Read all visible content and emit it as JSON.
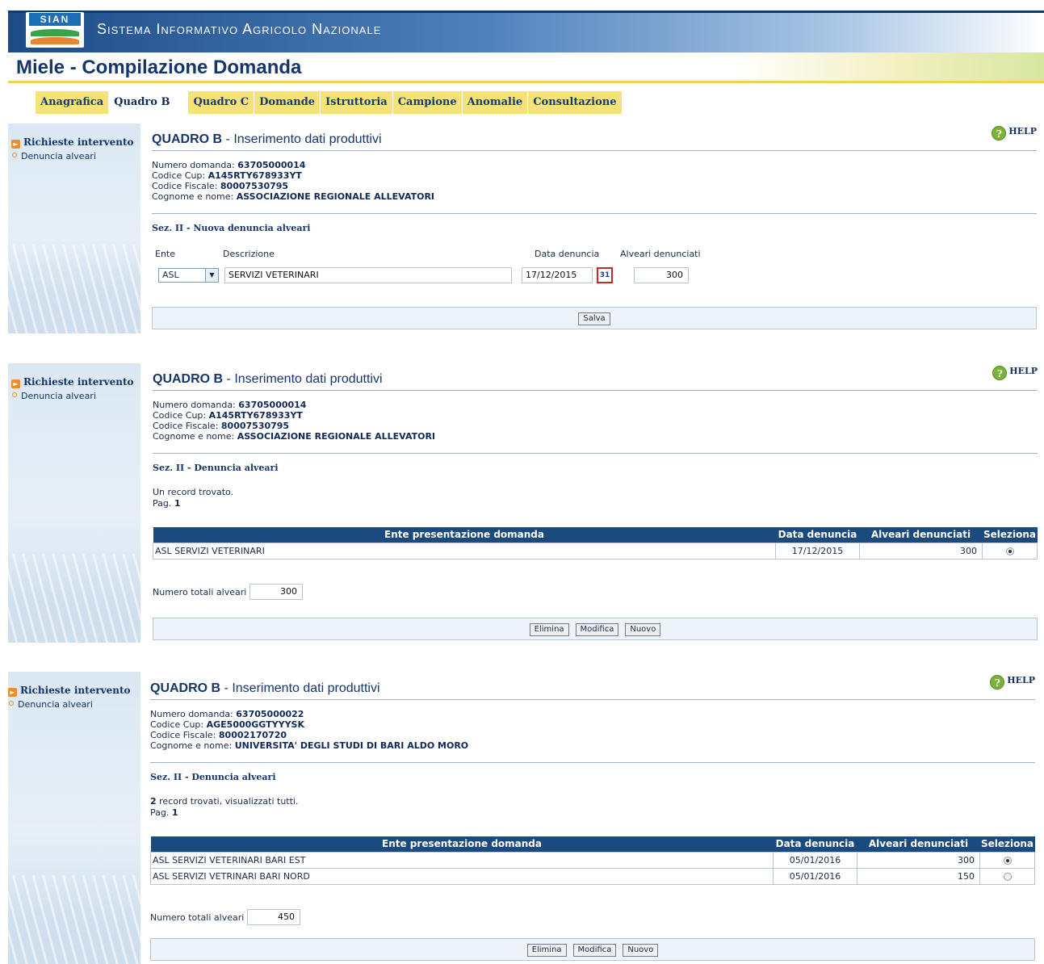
{
  "header": {
    "logo_text": "SIAN",
    "system_name": "Sistema Informativo Agricolo Nazionale",
    "app_title": "Miele - Compilazione Domanda"
  },
  "menu": [
    {
      "label": "Anagrafica"
    },
    {
      "label": "Quadro B"
    },
    {
      "label": "Quadro C"
    },
    {
      "label": "Domande"
    },
    {
      "label": "Istruttoria"
    },
    {
      "label": "Campione"
    },
    {
      "label": "Anomalie"
    },
    {
      "label": "Consultazione"
    }
  ],
  "sidebar": {
    "main_item": "Richieste intervento",
    "sub_item": "Denuncia alveari"
  },
  "common": {
    "help": "HELP",
    "title_strong": "QUADRO B",
    "title_rest": " - Inserimento dati produttivi",
    "lbl_numero": "Numero domanda: ",
    "lbl_cup": "Codice Cup: ",
    "lbl_cf": "Codice Fiscale: ",
    "lbl_nome": "Cognome e nome: ",
    "col_ente": "Ente presentazione domanda",
    "col_data": "Data denuncia",
    "col_alveari": "Alveari denunciati",
    "col_sel": "Seleziona",
    "lbl_totali": "Numero totali alveari",
    "btn_elimina": "Elimina",
    "btn_modifica": "Modifica",
    "btn_nuovo": "Nuovo",
    "pag_label": "Pag. ",
    "pag_value": "1"
  },
  "panel1": {
    "numero_domanda": "63705000014",
    "codice_cup": "A145RTY678933YT",
    "codice_fiscale": "80007530795",
    "cognome_nome": "ASSOCIAZIONE REGIONALE ALLEVATORI",
    "section": "Sez. II - Nuova denuncia alveari",
    "lbl_ente": "Ente",
    "lbl_descrizione": "Descrizione",
    "lbl_data": "Data denuncia",
    "lbl_alveari": "Alveari denunciati",
    "ente_value": "ASL",
    "descrizione_value": "SERVIZI VETERINARI",
    "data_value": "17/12/2015",
    "calendar_icon_text": "31",
    "alveari_value": "300",
    "btn_salva": "Salva"
  },
  "panel2": {
    "numero_domanda": "63705000014",
    "codice_cup": "A145RTY678933YT",
    "codice_fiscale": "80007530795",
    "cognome_nome": "ASSOCIAZIONE REGIONALE ALLEVATORI",
    "section": "Sez. II - Denuncia alveari",
    "records_msg": "Un record trovato.",
    "rows": [
      {
        "ente": "ASL SERVIZI VETERINARI",
        "data": "17/12/2015",
        "alveari": "300",
        "selected": true
      }
    ],
    "totale": "300"
  },
  "panel3": {
    "numero_domanda": "63705000022",
    "codice_cup": "AGE5000GGTYYYSK",
    "codice_fiscale": "80002170720",
    "cognome_nome": "UNIVERSITA' DEGLI STUDI DI BARI ALDO MORO",
    "section": "Sez. II - Denuncia alveari",
    "records_count": "2",
    "records_msg": " record trovati, visualizzati tutti.",
    "rows": [
      {
        "ente": "ASL SERVIZI VETERINARI BARI EST",
        "data": "05/01/2016",
        "alveari": "300",
        "selected": true
      },
      {
        "ente": "ASL SERVIZI VETRINARI BARI NORD",
        "data": "05/01/2016",
        "alveari": "150",
        "selected": false
      }
    ],
    "totale": "450"
  },
  "colors": {
    "header_blue": "#1d4b88",
    "menu_yellow": "#f5e27a",
    "table_header": "#1b4a7e",
    "help_green": "#7ab33a",
    "bullet_orange": "#f08c2a"
  }
}
